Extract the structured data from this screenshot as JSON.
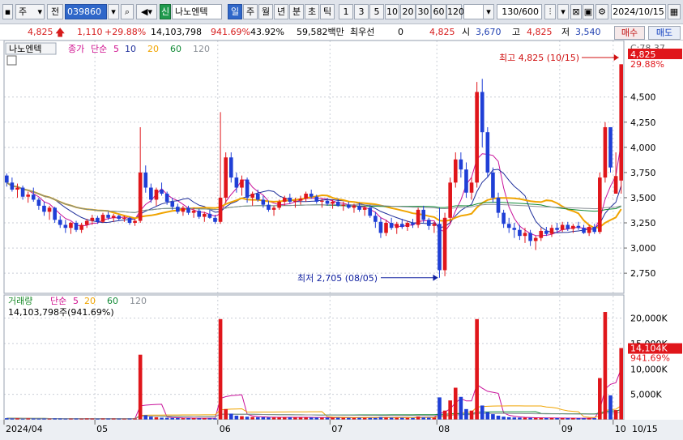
{
  "toolbar": {
    "market_select": "주",
    "prefix": "전",
    "code": "039860",
    "badge": "신",
    "name": "나노엔텍",
    "periods": [
      "일",
      "주",
      "월",
      "년",
      "분",
      "초",
      "틱"
    ],
    "intervals": [
      "1",
      "3",
      "5",
      "10",
      "20",
      "30",
      "60",
      "120"
    ],
    "count": "130/600",
    "date": "2024/10/15"
  },
  "quote": {
    "price": "4,825",
    "change": "1,110",
    "change_pct": "+29.88%",
    "volume": "14,103,798",
    "volume_ratio": "941.69%",
    "turnover_ratio": "43.92%",
    "amount": "59,582백만",
    "preferred_label": "최우선",
    "preferred_value": "0",
    "best_price": "4,825",
    "open_label": "시",
    "open": "3,670",
    "high_label": "고",
    "high": "4,825",
    "low_label": "저",
    "low": "3,540",
    "buy_label": "매수",
    "sell_label": "매도"
  },
  "colors": {
    "up": "#e0161b",
    "down": "#1f3fd6",
    "ma5": "#c8119a",
    "ma10": "#1f2f9b",
    "ma20": "#f0a400",
    "ma60": "#118a36",
    "ma120": "#8a8f96"
  },
  "chart_data": [
    {
      "type": "candlestick",
      "panel_label": "나노엔텍",
      "legend": [
        "종가",
        "단순",
        "5",
        "10",
        "20",
        "60",
        "120"
      ],
      "y_ticks": [
        2750,
        3000,
        3250,
        3500,
        3750,
        4000,
        4250,
        4500
      ],
      "y_tick_labels": [
        "2,750",
        "3,000",
        "3,250",
        "3,500",
        "3,750",
        "4,000",
        "4,250",
        "4,500"
      ],
      "ylim": [
        2550,
        4900
      ],
      "top_axis_labels": [
        "C:78.37",
        "4,825",
        "29.88%"
      ],
      "x_tick_labels": [
        "2024/04",
        "05",
        "06",
        "07",
        "08",
        "09",
        "10",
        "10/15"
      ],
      "annotations": {
        "high": "최고 4,825 (10/15)",
        "low": "최저 2,705 (08/05)"
      },
      "ohlc": [
        [
          3720,
          3740,
          3610,
          3650
        ],
        [
          3650,
          3700,
          3560,
          3580
        ],
        [
          3580,
          3640,
          3500,
          3600
        ],
        [
          3600,
          3620,
          3480,
          3510
        ],
        [
          3510,
          3560,
          3450,
          3530
        ],
        [
          3530,
          3600,
          3460,
          3480
        ],
        [
          3480,
          3500,
          3380,
          3420
        ],
        [
          3420,
          3460,
          3320,
          3360
        ],
        [
          3360,
          3420,
          3280,
          3400
        ],
        [
          3400,
          3410,
          3250,
          3280
        ],
        [
          3280,
          3320,
          3200,
          3230
        ],
        [
          3230,
          3280,
          3150,
          3200
        ],
        [
          3200,
          3260,
          3140,
          3250
        ],
        [
          3250,
          3270,
          3160,
          3180
        ],
        [
          3180,
          3250,
          3150,
          3230
        ],
        [
          3230,
          3290,
          3200,
          3270
        ],
        [
          3270,
          3330,
          3230,
          3300
        ],
        [
          3300,
          3320,
          3240,
          3260
        ],
        [
          3260,
          3350,
          3250,
          3330
        ],
        [
          3330,
          3360,
          3280,
          3300
        ],
        [
          3300,
          3340,
          3260,
          3320
        ],
        [
          3320,
          3330,
          3270,
          3290
        ],
        [
          3290,
          3320,
          3260,
          3300
        ],
        [
          3300,
          3310,
          3230,
          3250
        ],
        [
          3250,
          3290,
          3220,
          3270
        ],
        [
          3270,
          4200,
          3250,
          3750
        ],
        [
          3750,
          3820,
          3550,
          3600
        ],
        [
          3600,
          3640,
          3450,
          3480
        ],
        [
          3480,
          3600,
          3420,
          3580
        ],
        [
          3580,
          3650,
          3520,
          3540
        ],
        [
          3540,
          3560,
          3430,
          3460
        ],
        [
          3460,
          3500,
          3380,
          3410
        ],
        [
          3410,
          3440,
          3340,
          3360
        ],
        [
          3360,
          3420,
          3320,
          3400
        ],
        [
          3400,
          3420,
          3330,
          3350
        ],
        [
          3350,
          3400,
          3300,
          3370
        ],
        [
          3370,
          3390,
          3290,
          3310
        ],
        [
          3310,
          3360,
          3260,
          3340
        ],
        [
          3340,
          3380,
          3290,
          3300
        ],
        [
          3300,
          3330,
          3240,
          3260
        ],
        [
          3260,
          4350,
          3240,
          3500
        ],
        [
          3500,
          3950,
          3450,
          3900
        ],
        [
          3900,
          3950,
          3650,
          3700
        ],
        [
          3700,
          3750,
          3550,
          3600
        ],
        [
          3600,
          3720,
          3520,
          3680
        ],
        [
          3680,
          3700,
          3450,
          3500
        ],
        [
          3500,
          3560,
          3420,
          3540
        ],
        [
          3540,
          3580,
          3460,
          3480
        ],
        [
          3480,
          3520,
          3400,
          3430
        ],
        [
          3430,
          3470,
          3360,
          3380
        ],
        [
          3380,
          3420,
          3320,
          3400
        ],
        [
          3400,
          3480,
          3380,
          3460
        ],
        [
          3460,
          3520,
          3420,
          3500
        ],
        [
          3500,
          3540,
          3440,
          3460
        ],
        [
          3460,
          3500,
          3400,
          3470
        ],
        [
          3470,
          3520,
          3430,
          3490
        ],
        [
          3490,
          3560,
          3460,
          3540
        ],
        [
          3540,
          3580,
          3490,
          3510
        ],
        [
          3510,
          3530,
          3440,
          3460
        ],
        [
          3460,
          3490,
          3400,
          3470
        ],
        [
          3470,
          3500,
          3420,
          3440
        ],
        [
          3440,
          3480,
          3390,
          3460
        ],
        [
          3460,
          3490,
          3410,
          3420
        ],
        [
          3420,
          3460,
          3370,
          3430
        ],
        [
          3430,
          3460,
          3390,
          3400
        ],
        [
          3400,
          3440,
          3350,
          3420
        ],
        [
          3420,
          3450,
          3360,
          3380
        ],
        [
          3380,
          3420,
          3320,
          3400
        ],
        [
          3400,
          3430,
          3300,
          3320
        ],
        [
          3320,
          3360,
          3200,
          3260
        ],
        [
          3260,
          3300,
          3100,
          3150
        ],
        [
          3150,
          3280,
          3120,
          3250
        ],
        [
          3250,
          3300,
          3180,
          3200
        ],
        [
          3200,
          3260,
          3140,
          3240
        ],
        [
          3240,
          3290,
          3190,
          3210
        ],
        [
          3210,
          3270,
          3170,
          3250
        ],
        [
          3250,
          3290,
          3200,
          3230
        ],
        [
          3230,
          3400,
          3200,
          3380
        ],
        [
          3380,
          3420,
          3250,
          3280
        ],
        [
          3280,
          3300,
          3180,
          3220
        ],
        [
          3220,
          3260,
          3150,
          3240
        ],
        [
          3240,
          3400,
          2705,
          2780
        ],
        [
          2780,
          3350,
          2720,
          3300
        ],
        [
          3300,
          3700,
          3250,
          3650
        ],
        [
          3650,
          3950,
          3600,
          3880
        ],
        [
          3880,
          3950,
          3700,
          3780
        ],
        [
          3780,
          3850,
          3500,
          3550
        ],
        [
          3550,
          3700,
          3480,
          3650
        ],
        [
          3650,
          4650,
          3600,
          4550
        ],
        [
          4550,
          4680,
          4000,
          4150
        ],
        [
          4150,
          4200,
          3700,
          3750
        ],
        [
          3750,
          3800,
          3450,
          3500
        ],
        [
          3500,
          3550,
          3300,
          3350
        ],
        [
          3350,
          3380,
          3200,
          3240
        ],
        [
          3240,
          3300,
          3150,
          3200
        ],
        [
          3200,
          3250,
          3100,
          3180
        ],
        [
          3180,
          3230,
          3080,
          3120
        ],
        [
          3120,
          3200,
          3050,
          3150
        ],
        [
          3150,
          3180,
          3020,
          3070
        ],
        [
          3070,
          3120,
          2980,
          3100
        ],
        [
          3100,
          3200,
          3070,
          3170
        ],
        [
          3170,
          3210,
          3120,
          3140
        ],
        [
          3140,
          3230,
          3110,
          3200
        ],
        [
          3200,
          3250,
          3150,
          3180
        ],
        [
          3180,
          3260,
          3160,
          3230
        ],
        [
          3230,
          3260,
          3170,
          3190
        ],
        [
          3190,
          3240,
          3150,
          3220
        ],
        [
          3220,
          3260,
          3180,
          3200
        ],
        [
          3200,
          3230,
          3140,
          3150
        ],
        [
          3150,
          3230,
          3120,
          3210
        ],
        [
          3210,
          3240,
          3140,
          3160
        ],
        [
          3160,
          3750,
          3140,
          3700
        ],
        [
          3700,
          4250,
          3650,
          4200
        ],
        [
          4200,
          4200,
          3750,
          3800
        ],
        [
          3540,
          3950,
          3540,
          3715
        ],
        [
          3670,
          4825,
          3540,
          4825
        ]
      ]
    },
    {
      "type": "bar",
      "panel_label": "거래량",
      "legend": [
        "단순",
        "5",
        "20",
        "60",
        "120"
      ],
      "current_label": "14,103,798주(941.69%)",
      "y_ticks": [
        5000,
        10000,
        15000,
        20000
      ],
      "y_tick_labels": [
        "5,000K",
        "10,000K",
        "15,000K",
        "20,000K"
      ],
      "ylim": [
        0,
        22000
      ],
      "last_tags": [
        "14,104K",
        "941.69%"
      ],
      "volumes_k": [
        300,
        250,
        280,
        200,
        260,
        240,
        220,
        230,
        210,
        260,
        240,
        200,
        220,
        230,
        210,
        250,
        230,
        200,
        240,
        220,
        230,
        210,
        200,
        220,
        240,
        12800,
        900,
        600,
        500,
        400,
        380,
        350,
        330,
        300,
        320,
        310,
        290,
        300,
        280,
        270,
        19800,
        2100,
        1200,
        800,
        700,
        600,
        550,
        500,
        480,
        460,
        450,
        470,
        500,
        480,
        460,
        450,
        470,
        440,
        430,
        420,
        400,
        420,
        410,
        400,
        390,
        380,
        400,
        390,
        370,
        360,
        500,
        450,
        420,
        400,
        390,
        380,
        370,
        600,
        450,
        420,
        400,
        4400,
        1800,
        3800,
        6300,
        4500,
        2100,
        1800,
        19800,
        2800,
        1500,
        1100,
        800,
        600,
        500,
        450,
        420,
        400,
        380,
        360,
        350,
        340,
        330,
        320,
        310,
        300,
        320,
        300,
        290,
        300,
        310,
        8200,
        21200,
        4800,
        1900,
        14100
      ]
    }
  ]
}
